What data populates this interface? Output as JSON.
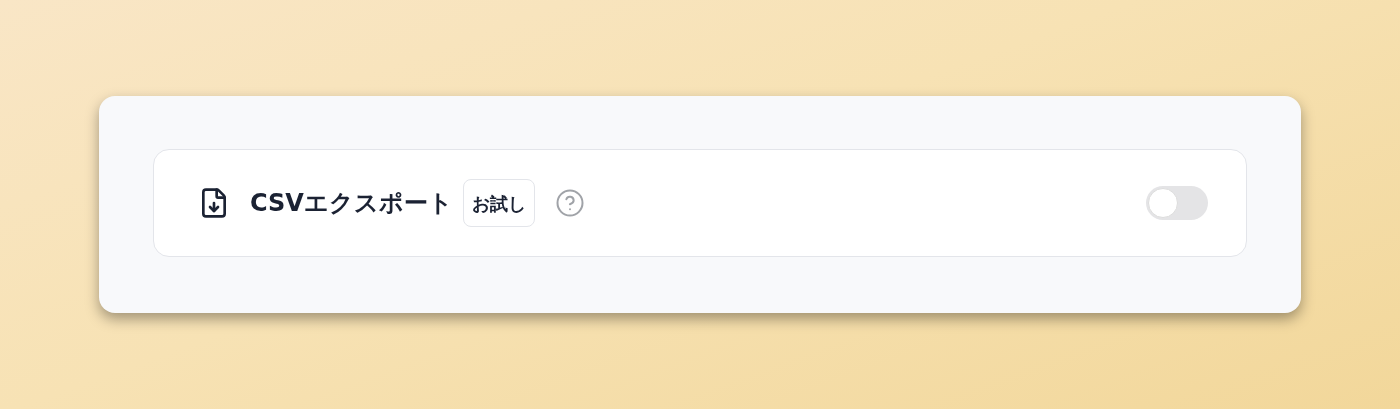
{
  "feature": {
    "label": "CSVエクスポート",
    "badge": "お試し",
    "on": false
  }
}
